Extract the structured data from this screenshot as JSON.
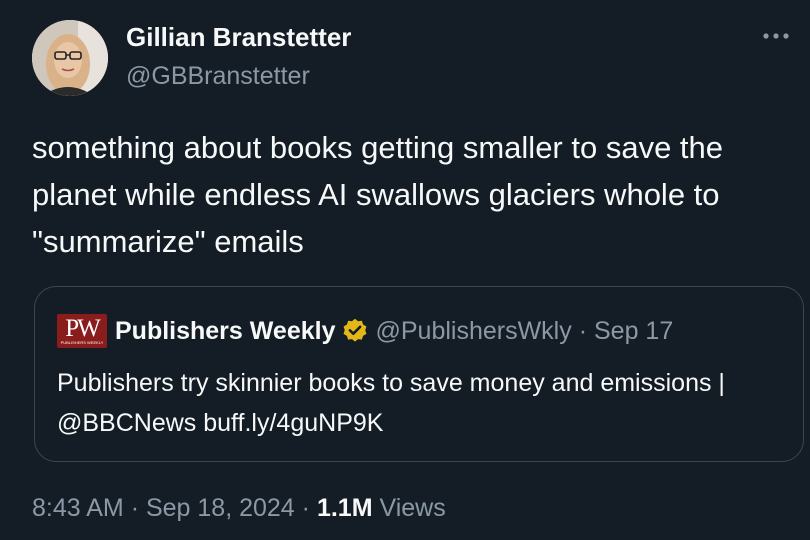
{
  "author": {
    "display_name": "Gillian Branstetter",
    "handle": "@GBBranstetter"
  },
  "tweet": {
    "text": "something about books getting smaller to save the planet while endless AI swallows glaciers whole to \"summarize\" emails"
  },
  "quoted": {
    "logo_text": "PW",
    "logo_subtext": "PUBLISHERS WEEKLY",
    "display_name": "Publishers Weekly",
    "handle": "@PublishersWkly",
    "separator": "·",
    "date": "Sep 17",
    "text": "Publishers try skinnier books to save money and emissions | @BBCNews buff.ly/4guNP9K"
  },
  "meta": {
    "time": "8:43 AM",
    "sep1": "·",
    "date": "Sep 18, 2024",
    "sep2": "·",
    "views_count": "1.1M",
    "views_label": "Views"
  },
  "icons": {
    "more": "more-horizontal-icon",
    "verified": "verified-badge-icon"
  },
  "colors": {
    "background": "#141d26",
    "text_primary": "#f7f9f9",
    "text_secondary": "#8b98a5",
    "card_border": "#3a4753",
    "pw_brand": "#8a1c1c",
    "verified_gold": "#e2b719"
  }
}
